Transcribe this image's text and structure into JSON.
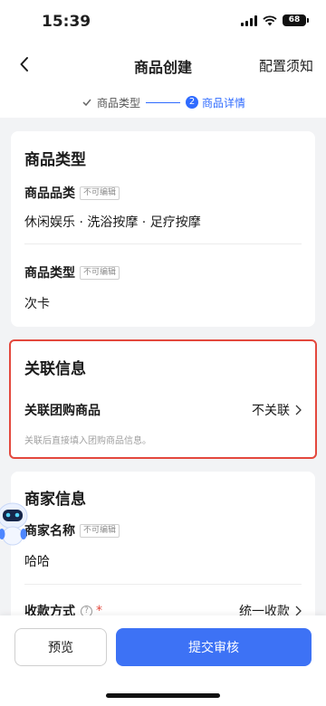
{
  "status_bar": {
    "time": "15:39",
    "battery": "68"
  },
  "nav": {
    "title": "商品创建",
    "right_link": "配置须知"
  },
  "steps": [
    {
      "label": "商品类型",
      "state": "done"
    },
    {
      "number": "2",
      "label": "商品详情",
      "state": "active"
    }
  ],
  "product_type_section": {
    "title": "商品类型",
    "category_label": "商品品类",
    "category_tag": "不可编辑",
    "category_value": "休闲娱乐 · 洗浴按摩 · 足疗按摩",
    "type_label": "商品类型",
    "type_tag": "不可编辑",
    "type_value": "次卡"
  },
  "association_section": {
    "title": "关联信息",
    "row_label": "关联团购商品",
    "row_value": "不关联",
    "hint": "关联后直接填入团购商品信息。"
  },
  "merchant_section": {
    "title": "商家信息",
    "name_label": "商家名称",
    "name_tag": "不可编辑",
    "name_value": "哈哈",
    "payment_label": "收款方式",
    "payment_required": "*",
    "payment_value": "统一收款"
  },
  "bottom": {
    "preview_label": "预览",
    "submit_label": "提交审核"
  },
  "colors": {
    "accent": "#3d72f5",
    "highlight_border": "#e3483d"
  }
}
